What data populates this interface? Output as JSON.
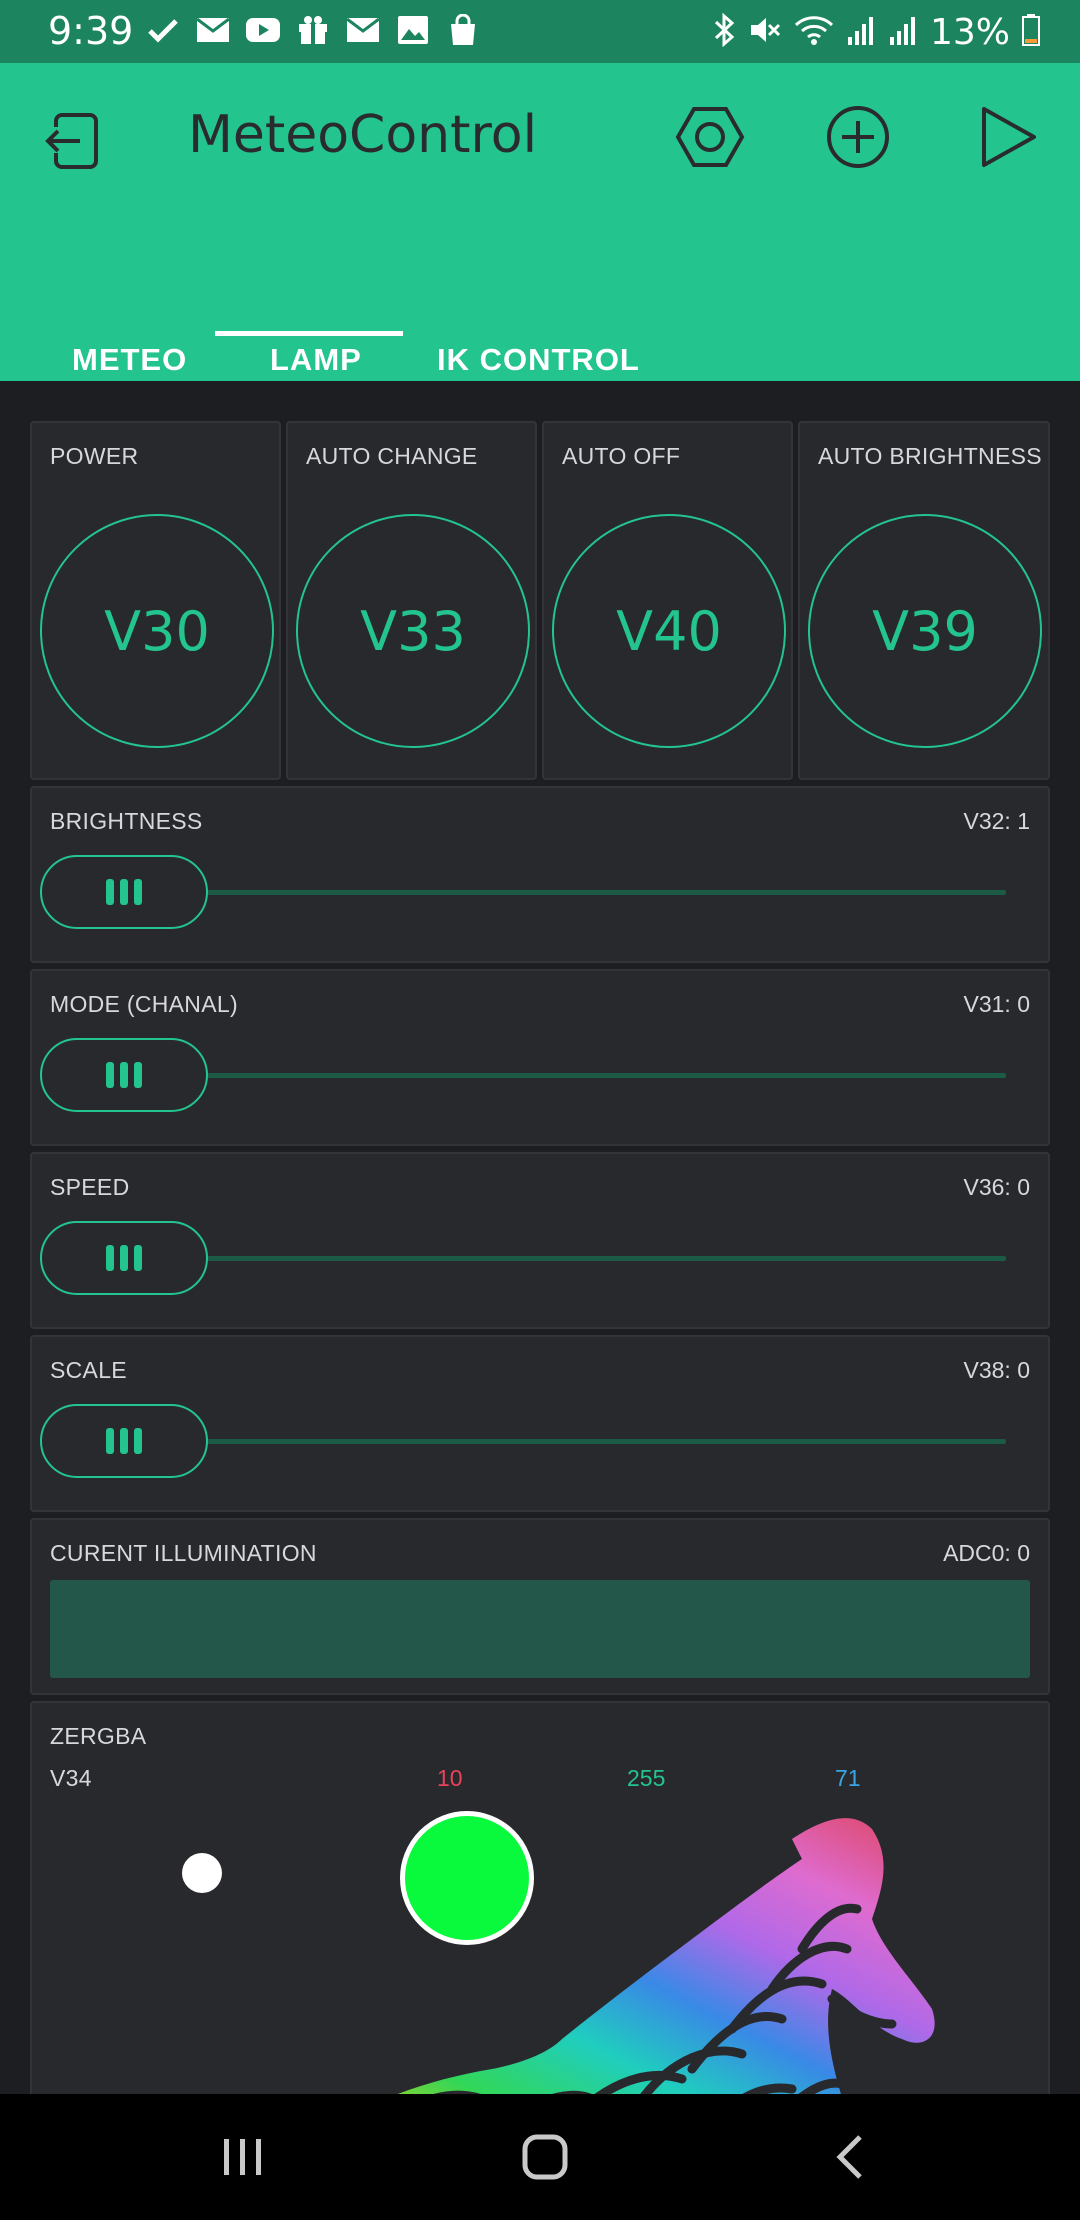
{
  "status_bar": {
    "time": "9:39",
    "battery_text": "13%",
    "left_icons": [
      "check-icon",
      "mail-icon",
      "youtube-icon",
      "gift-icon",
      "mail-icon",
      "image-icon",
      "shopping-bag-icon"
    ],
    "right_icons": [
      "bluetooth-icon",
      "mute-icon",
      "wifi-icon",
      "signal-icon",
      "signal-icon",
      "battery-icon"
    ]
  },
  "app_bar": {
    "title": "MeteoControl",
    "actions": [
      "back-icon",
      "settings-hexagon-icon",
      "add-icon",
      "play-icon"
    ]
  },
  "tabs": [
    {
      "label": "METEO",
      "active": false
    },
    {
      "label": "LAMP",
      "active": true
    },
    {
      "label": "IK CONTROL",
      "active": false
    }
  ],
  "buttons": [
    {
      "title": "POWER",
      "pin": "V30"
    },
    {
      "title": "AUTO CHANGE",
      "pin": "V33"
    },
    {
      "title": "AUTO OFF",
      "pin": "V40"
    },
    {
      "title": "AUTO BRIGHTNESS",
      "pin": "V39"
    }
  ],
  "sliders": [
    {
      "title": "BRIGHTNESS",
      "value_text": "V32: 1",
      "value": 1
    },
    {
      "title": "MODE (CHANAL)",
      "value_text": "V31: 0",
      "value": 0
    },
    {
      "title": "SPEED",
      "value_text": "V36: 0",
      "value": 0
    },
    {
      "title": "SCALE",
      "value_text": "V38: 0",
      "value": 0
    }
  ],
  "level": {
    "title": "CURENT ILLUMINATION",
    "value_text": "ADC0: 0",
    "value": 0
  },
  "zergba": {
    "title": "ZERGBA",
    "pin": "V34",
    "r": "10",
    "g": "255",
    "b": "71",
    "colors": {
      "r": "#e8435a",
      "g": "#23c48e",
      "b": "#3aa5e6",
      "swatch": "#09f93c"
    }
  },
  "colors": {
    "accent": "#23c48e",
    "status_bar": "#1c845f",
    "background": "#1d1e22",
    "panel": "#28292d"
  },
  "nav_bar": [
    "recents-icon",
    "home-icon",
    "back-icon"
  ]
}
